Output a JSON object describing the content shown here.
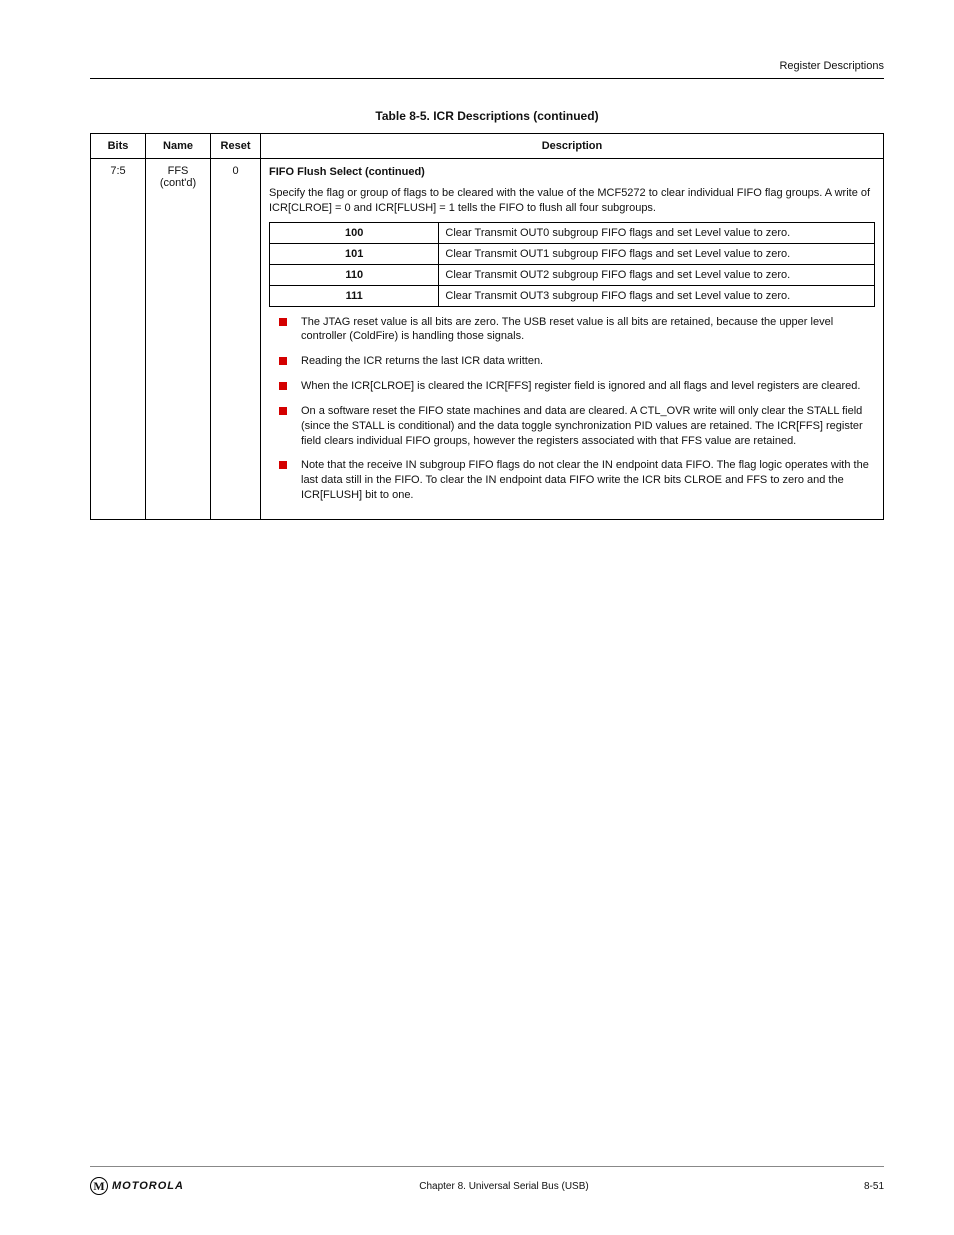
{
  "header": {
    "running_title": "Register Descriptions"
  },
  "table": {
    "caption": "Table 8-5. ICR Descriptions (continued)",
    "columns": [
      "Bits",
      "Name",
      "Reset",
      "Description"
    ],
    "row": {
      "bits": "7:5",
      "name": "FFS\n(cont'd)",
      "reset": "0",
      "desc_intro": "FIFO Flush Select (continued)",
      "desc_para": "Specify the flag or group of flags to be cleared with the value of the MCF5272 to clear individual FIFO flag groups. A write of ICR[CLROE] = 0 and ICR[FLUSH] = 1 tells the FIFO to flush all four subgroups.",
      "subtable": [
        {
          "code": "100",
          "meaning": "Clear Transmit OUT0 subgroup FIFO flags and set Level value to zero."
        },
        {
          "code": "101",
          "meaning": "Clear Transmit OUT1 subgroup FIFO flags and set Level value to zero."
        },
        {
          "code": "110",
          "meaning": "Clear Transmit OUT2 subgroup FIFO flags and set Level value to zero."
        },
        {
          "code": "111",
          "meaning": "Clear Transmit OUT3 subgroup FIFO flags and set Level value to zero."
        }
      ],
      "bullets": [
        "The JTAG reset value is all bits are zero. The USB reset value is all bits are retained, because the upper level controller (ColdFire) is handling those signals.",
        "Reading the ICR returns the last ICR data written.",
        "When the ICR[CLROE] is cleared the ICR[FFS] register field is ignored and all flags and level registers are cleared.",
        "On a software reset the FIFO state machines and data are cleared. A CTL_OVR write will only clear the STALL field (since the STALL is conditional) and the data toggle synchronization PID values are retained. The ICR[FFS] register field clears individual FIFO groups, however the registers associated with that FFS value are retained.",
        "Note that the receive IN subgroup FIFO flags do not clear the IN endpoint data FIFO. The flag logic operates with the last data still in the FIFO. To clear the IN endpoint data FIFO write the ICR bits CLROE and FFS to zero and the ICR[FLUSH] bit to one."
      ]
    }
  },
  "footer": {
    "center": "Chapter 8. Universal Serial Bus (USB)",
    "page": "8-51",
    "logo_emblem": "M",
    "logo_word": "MOTOROLA"
  }
}
